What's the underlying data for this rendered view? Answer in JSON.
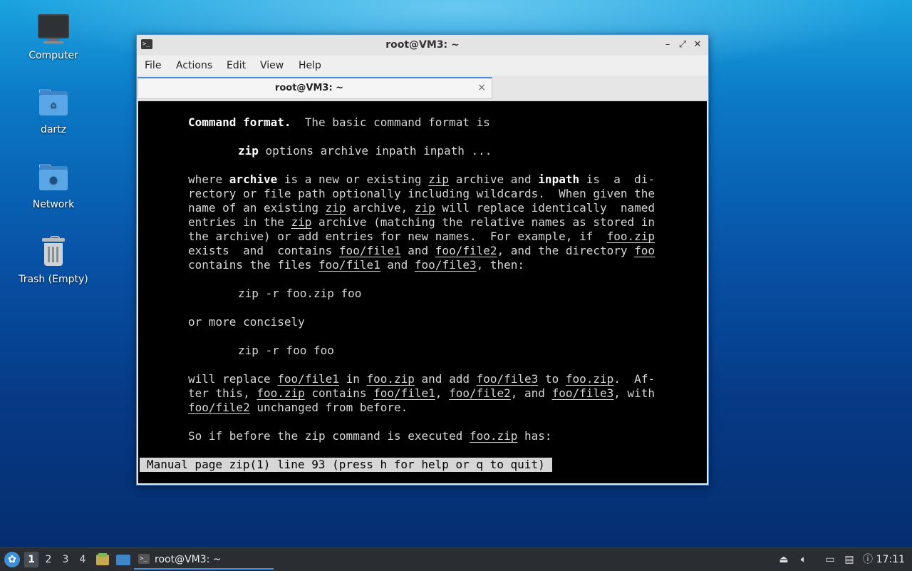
{
  "desktop": {
    "icons": [
      {
        "label": "Computer"
      },
      {
        "label": "dartz"
      },
      {
        "label": "Network"
      },
      {
        "label": "Trash (Empty)"
      }
    ]
  },
  "window": {
    "title": "root@VM3: ~",
    "controls": {
      "minimize": "–",
      "maximize": "⤢",
      "close": "✕"
    },
    "menu": [
      "File",
      "Actions",
      "Edit",
      "View",
      "Help"
    ],
    "tab": {
      "label": "root@VM3: ~",
      "close": "×"
    }
  },
  "terminal": {
    "lines": [
      {
        "indent": 7,
        "segments": [
          {
            "t": "Command format.",
            "s": "b"
          },
          {
            "t": "  The basic command format is"
          }
        ]
      },
      {
        "indent": 14,
        "segments": [
          {
            "t": "zip",
            "s": "b"
          },
          {
            "t": " options archive inpath inpath ..."
          }
        ]
      },
      {
        "indent": 7,
        "segments": [
          {
            "t": "where "
          },
          {
            "t": "archive",
            "s": "b"
          },
          {
            "t": " is a new or existing "
          },
          {
            "t": "zip",
            "s": "u"
          },
          {
            "t": " archive and "
          },
          {
            "t": "inpath",
            "s": "b"
          },
          {
            "t": " is  a  di-"
          }
        ]
      },
      {
        "indent": 7,
        "segments": [
          {
            "t": "rectory or file path optionally including wildcards.  When given the"
          }
        ]
      },
      {
        "indent": 7,
        "segments": [
          {
            "t": "name of an existing "
          },
          {
            "t": "zip",
            "s": "u"
          },
          {
            "t": " archive, "
          },
          {
            "t": "zip",
            "s": "u"
          },
          {
            "t": " will replace identically  named"
          }
        ]
      },
      {
        "indent": 7,
        "segments": [
          {
            "t": "entries in the "
          },
          {
            "t": "zip",
            "s": "u"
          },
          {
            "t": " archive (matching the relative names as stored in"
          }
        ]
      },
      {
        "indent": 7,
        "segments": [
          {
            "t": "the archive) or add entries for new names.  For example, if  "
          },
          {
            "t": "foo.zip",
            "s": "u"
          }
        ]
      },
      {
        "indent": 7,
        "segments": [
          {
            "t": "exists  and  contains "
          },
          {
            "t": "foo/file1",
            "s": "u"
          },
          {
            "t": " and "
          },
          {
            "t": "foo/file2",
            "s": "u"
          },
          {
            "t": ", and the directory "
          },
          {
            "t": "foo",
            "s": "u"
          }
        ]
      },
      {
        "indent": 7,
        "segments": [
          {
            "t": "contains the files "
          },
          {
            "t": "foo/file1",
            "s": "u"
          },
          {
            "t": " and "
          },
          {
            "t": "foo/file3",
            "s": "u"
          },
          {
            "t": ", then:"
          }
        ]
      },
      {
        "indent": 14,
        "segments": [
          {
            "t": "zip -r foo.zip foo"
          }
        ]
      },
      {
        "indent": 7,
        "segments": [
          {
            "t": "or more concisely"
          }
        ]
      },
      {
        "indent": 14,
        "segments": [
          {
            "t": "zip -r foo foo"
          }
        ]
      },
      {
        "indent": 7,
        "segments": [
          {
            "t": "will replace "
          },
          {
            "t": "foo/file1",
            "s": "u"
          },
          {
            "t": " in "
          },
          {
            "t": "foo.zip",
            "s": "u"
          },
          {
            "t": " and add "
          },
          {
            "t": "foo/file3",
            "s": "u"
          },
          {
            "t": " to "
          },
          {
            "t": "foo.zip",
            "s": "u"
          },
          {
            "t": ".  Af-"
          }
        ]
      },
      {
        "indent": 7,
        "segments": [
          {
            "t": "ter this, "
          },
          {
            "t": "foo.zip",
            "s": "u"
          },
          {
            "t": " contains "
          },
          {
            "t": "foo/file1",
            "s": "u"
          },
          {
            "t": ", "
          },
          {
            "t": "foo/file2",
            "s": "u"
          },
          {
            "t": ", and "
          },
          {
            "t": "foo/file3",
            "s": "u"
          },
          {
            "t": ", with"
          }
        ]
      },
      {
        "indent": 7,
        "segments": [
          {
            "t": "foo/file2",
            "s": "u"
          },
          {
            "t": " unchanged from before."
          }
        ]
      },
      {
        "indent": 7,
        "segments": [
          {
            "t": "So if before the zip command is executed "
          },
          {
            "t": "foo.zip",
            "s": "u"
          },
          {
            "t": " has:"
          }
        ]
      }
    ],
    "status": "Manual page zip(1) line 93 (press h for help or q to quit)"
  },
  "taskbar": {
    "workspaces": [
      "1",
      "2",
      "3",
      "4"
    ],
    "active_workspace": "1",
    "task_label": "root@VM3: ~",
    "clock": "17:11"
  }
}
